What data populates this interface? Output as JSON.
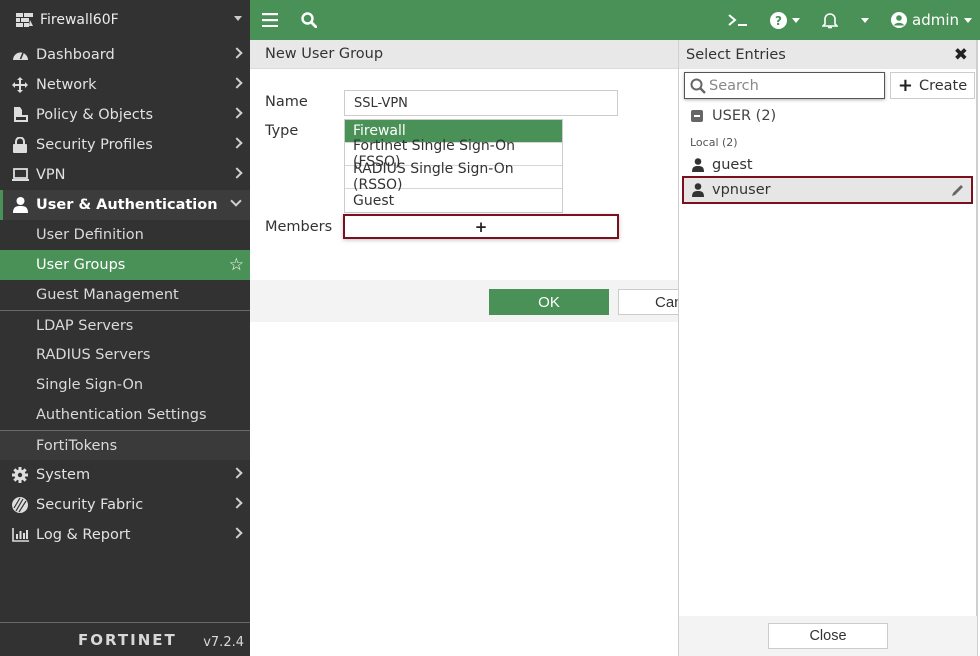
{
  "sidebar": {
    "device_name": "Firewall60F",
    "nav": [
      {
        "label": "Dashboard",
        "icon": "dashboard-icon"
      },
      {
        "label": "Network",
        "icon": "network-icon"
      },
      {
        "label": "Policy & Objects",
        "icon": "policy-icon"
      },
      {
        "label": "Security Profiles",
        "icon": "lock-icon"
      },
      {
        "label": "VPN",
        "icon": "laptop-icon"
      },
      {
        "label": "User & Authentication",
        "icon": "user-icon",
        "expanded": true
      }
    ],
    "sub_items": [
      {
        "label": "User Definition"
      },
      {
        "label": "User Groups",
        "active": true
      },
      {
        "label": "Guest Management"
      },
      {
        "label": "LDAP Servers"
      },
      {
        "label": "RADIUS Servers"
      },
      {
        "label": "Single Sign-On"
      },
      {
        "label": "Authentication Settings"
      },
      {
        "label": "FortiTokens"
      }
    ],
    "nav_bottom": [
      {
        "label": "System",
        "icon": "gear-icon"
      },
      {
        "label": "Security Fabric",
        "icon": "fabric-icon"
      },
      {
        "label": "Log & Report",
        "icon": "chart-icon"
      }
    ],
    "brand": "FORTINET",
    "version": "v7.2.4"
  },
  "topbar": {
    "user": "admin"
  },
  "form": {
    "title": "New User Group",
    "name_label": "Name",
    "name_value": "SSL-VPN",
    "type_label": "Type",
    "type_options": [
      {
        "label": "Firewall",
        "selected": true
      },
      {
        "label": "Fortinet Single Sign-On (FSSO)"
      },
      {
        "label": "RADIUS Single Sign-On (RSSO)"
      },
      {
        "label": "Guest"
      }
    ],
    "members_label": "Members",
    "members_add": "+",
    "ok_label": "OK",
    "cancel_label": "Cancel"
  },
  "select_entries": {
    "title": "Select Entries",
    "search_placeholder": "Search",
    "create_label": "Create",
    "group_label": "USER (2)",
    "subgroup_label": "Local (2)",
    "entries": [
      {
        "label": "guest"
      },
      {
        "label": "vpnuser",
        "highlighted": true
      }
    ],
    "close_label": "Close"
  },
  "colors": {
    "accent": "#4a9157",
    "sidebar_bg": "#323232",
    "highlight_border": "#7a0f1f"
  }
}
